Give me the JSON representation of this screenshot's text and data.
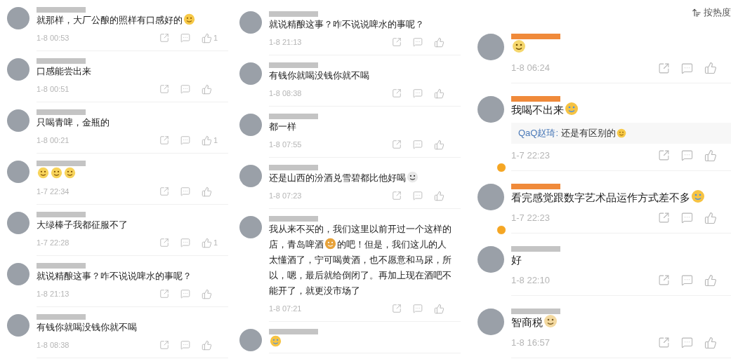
{
  "columns": [
    {
      "comments": [
        {
          "body": [
            {
              "kind": "text",
              "text": "就那样，大厂公酿的照样有口感好的"
            },
            {
              "kind": "grin"
            }
          ],
          "time": "1-8 00:53",
          "likes": "1"
        },
        {
          "body": [
            {
              "kind": "text",
              "text": "口感能尝出来"
            }
          ],
          "time": "1-8 00:51"
        },
        {
          "body": [
            {
              "kind": "text",
              "text": "只喝青啤，金瓶的"
            }
          ],
          "time": "1-8 00:21",
          "likes": "1"
        },
        {
          "body": [
            {
              "kind": "think"
            },
            {
              "kind": "think"
            },
            {
              "kind": "think"
            }
          ],
          "time": "1-7 22:34"
        },
        {
          "body": [
            {
              "kind": "text",
              "text": "大绿棒子我都征服不了"
            }
          ],
          "time": "1-7 22:28",
          "likes": "1"
        },
        {
          "body": [
            {
              "kind": "text",
              "text": "就说精酿这事？咋不说说啤水的事呢？"
            }
          ],
          "time": "1-8 21:13"
        },
        {
          "body": [
            {
              "kind": "text",
              "text": "有钱你就喝没钱你就不喝"
            }
          ],
          "time": "1-8 08:38"
        }
      ]
    },
    {
      "comments": [
        {
          "body": [
            {
              "kind": "text",
              "text": "就说精酿这事？咋不说说啤水的事呢？"
            }
          ],
          "time": "1-8 21:13"
        },
        {
          "body": [
            {
              "kind": "text",
              "text": "有钱你就喝没钱你就不喝"
            }
          ],
          "time": "1-8 08:38"
        },
        {
          "body": [
            {
              "kind": "text",
              "text": "都一样"
            }
          ],
          "time": "1-8 07:55"
        },
        {
          "body": [
            {
              "kind": "text",
              "text": "还是山西的汾酒兑雪碧都比他好喝"
            },
            {
              "kind": "panda"
            }
          ],
          "time": "1-8 07:23"
        },
        {
          "body": [
            {
              "kind": "text",
              "text": "我从来不买的，我们这里以前开过一个这样的"
            },
            {
              "kind": "break"
            },
            {
              "kind": "text",
              "text": "店，青岛啤酒"
            },
            {
              "kind": "beer"
            },
            {
              "kind": "text",
              "text": "的吧！但是，我们这儿的人"
            },
            {
              "kind": "break"
            },
            {
              "kind": "text",
              "text": "太懂酒了，宁可喝黄酒，也不愿意和马尿，所"
            },
            {
              "kind": "break"
            },
            {
              "kind": "text",
              "text": "以，嗯，最后就给倒闭了。再加上现在酒吧不"
            },
            {
              "kind": "break"
            },
            {
              "kind": "text",
              "text": "能开了，就更没市场了"
            }
          ],
          "time": "1-8 07:21"
        },
        {
          "body": [
            {
              "kind": "laugh"
            }
          ]
        }
      ]
    },
    {
      "sort": "按热度",
      "comments": [
        {
          "vip": true,
          "verified": false,
          "body": [
            {
              "kind": "smile"
            }
          ],
          "time": "1-8 06:24"
        },
        {
          "vip": true,
          "verified": true,
          "body": [
            {
              "kind": "text",
              "text": "我喝不出来"
            },
            {
              "kind": "laugh"
            }
          ],
          "reply": {
            "user": "QaQ赵琦:",
            "body": [
              {
                "kind": "text",
                "text": "还是有区别的"
              },
              {
                "kind": "grin"
              }
            ]
          },
          "time": "1-7 22:23"
        },
        {
          "vip": true,
          "verified": true,
          "body": [
            {
              "kind": "text",
              "text": "看完感觉跟数字艺术品运作方式差不多"
            },
            {
              "kind": "laugh"
            }
          ],
          "time": "1-7 22:23"
        },
        {
          "vip": false,
          "verified": false,
          "body": [
            {
              "kind": "text",
              "text": "好"
            }
          ],
          "time": "1-8 22:10"
        },
        {
          "vip": false,
          "verified": false,
          "body": [
            {
              "kind": "text",
              "text": "智商税"
            },
            {
              "kind": "dog"
            }
          ],
          "time": "1-8 16:57"
        }
      ]
    }
  ]
}
